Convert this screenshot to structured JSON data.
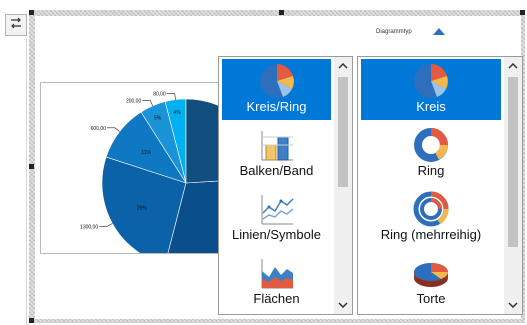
{
  "toolbar": {
    "swap_icon": "swap-arrows-icon"
  },
  "header": {
    "diagramm_typ_label": "Diagrammtyp",
    "toggle_icon": "triangle-up-icon"
  },
  "chart_data": {
    "type": "pie",
    "labels": [
      "80,00",
      "200,00",
      "600,00",
      "1300,00"
    ],
    "percent_labels": [
      "4%",
      "5%",
      "11%",
      "26%"
    ],
    "values": [
      80,
      200,
      600,
      1300
    ],
    "colors": [
      "#00b0f0",
      "#1a94d8",
      "#0f78c2",
      "#0c62a8",
      "#0a4f8c",
      "#104f80"
    ]
  },
  "category_list": {
    "items": [
      {
        "label": "Kreis/Ring",
        "icon": "pie-ring-chart-icon",
        "selected": true
      },
      {
        "label": "Balken/Band",
        "icon": "bar-chart-icon",
        "selected": false
      },
      {
        "label": "Linien/Symbole",
        "icon": "line-chart-icon",
        "selected": false
      },
      {
        "label": "Flächen",
        "icon": "area-chart-icon",
        "selected": false
      }
    ]
  },
  "subtype_list": {
    "items": [
      {
        "label": "Kreis",
        "icon": "pie-chart-icon",
        "selected": true
      },
      {
        "label": "Ring",
        "icon": "ring-chart-icon",
        "selected": false
      },
      {
        "label": "Ring (mehrreihig)",
        "icon": "multi-ring-chart-icon",
        "selected": false
      },
      {
        "label": "Torte",
        "icon": "3d-pie-chart-icon",
        "selected": false
      }
    ]
  },
  "colors": {
    "selection": "#0078d7",
    "accent": "#2f6fbf"
  }
}
